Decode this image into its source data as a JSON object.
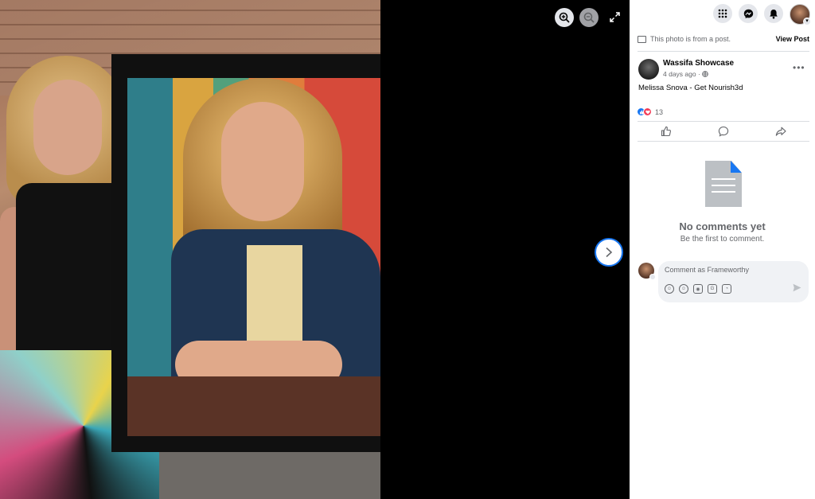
{
  "viewer": {
    "zoom_in_icon": "magnifier-plus-icon",
    "zoom_out_icon": "magnifier-minus-icon",
    "expand_icon": "expand-icon",
    "next_icon": "chevron-right-icon",
    "photo_alt": "Woman holding framed painted portrait of herself"
  },
  "topbar": {
    "icons": [
      "apps-grid-icon",
      "messenger-icon",
      "notifications-bell-icon",
      "account-avatar"
    ]
  },
  "post_info": {
    "from_text": "This photo is from a post.",
    "view_post_label": "View Post"
  },
  "post": {
    "author": "Wassifa Showcase",
    "time": "4 days ago ·",
    "text": "Melissa Snova - Get Nourish3d",
    "reaction_count": "13",
    "more_label": "•••"
  },
  "comments": {
    "empty_title": "No comments yet",
    "empty_subtitle": "Be the first to comment.",
    "input_placeholder": "Comment as Frameworthy"
  },
  "colors": {
    "accent": "#1877f2",
    "panel_bg": "#ffffff",
    "muted_text": "#65676b",
    "love": "#f33e58"
  }
}
